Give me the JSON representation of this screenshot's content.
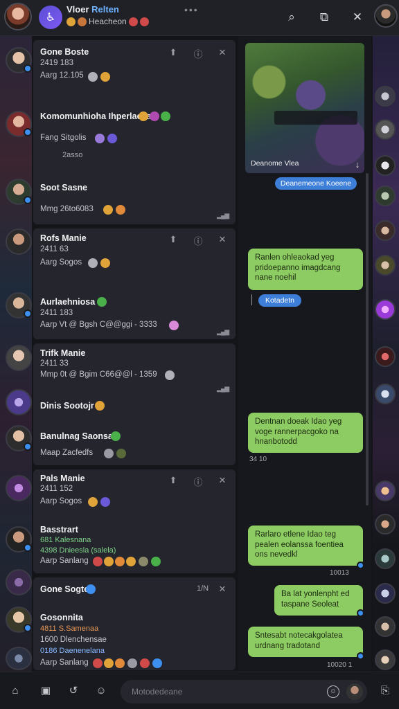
{
  "header": {
    "title_part1": "Vloer",
    "title_part2": "Relten",
    "subtitle": "Heacheon",
    "actions": [
      "search",
      "new-chat",
      "close"
    ]
  },
  "cards": [
    {
      "rows": [
        {
          "sender": "Gone Boste",
          "line1": "2419 183",
          "line2": "Aarg  12.105"
        },
        {
          "sender": "Komomunhioha Ihperlaesa",
          "line1": "Fang  Sitgolis",
          "line2": "2asso"
        },
        {
          "sender": "Soot Sasne",
          "line1": "Mmg  26to6083"
        }
      ]
    },
    {
      "rows": [
        {
          "sender": "Rofs Manie",
          "line1": "2411 63",
          "line2": "Aarg  Sogos"
        },
        {
          "sender": "Aurlaehniosa",
          "line1": "2411 183",
          "line2": "Aarp  Vt @ Bgsh  C@@ggi - 3333"
        }
      ]
    },
    {
      "rows": [
        {
          "sender": "Trifk Manie",
          "line1": "2411 33",
          "line2": "Mmp  0t @ Bgim  C66@@l - 1359"
        },
        {
          "sender": "Dinis Sootojr"
        },
        {
          "sender": "Banulnag Saonsa",
          "line1": "Maap  Zacfedfs"
        }
      ]
    },
    {
      "rows": [
        {
          "sender": "Pals Manie",
          "line1": "2411 152",
          "line2": "Aarp  Sogos"
        },
        {
          "sender": "Basstrart",
          "line1": "681  Kalesnana",
          "line2": "4398  Dnieesla (salela)",
          "line3": "Aarp  Sanlang"
        }
      ]
    },
    {
      "rows": [
        {
          "sender": "Gone Sogte",
          "count": "1/N"
        },
        {
          "sender": "Gosonnita",
          "line1": "4811 S.Samenaa",
          "line2": "1600  Dlenchensae",
          "line3": "0186  Daenenelana",
          "line4": "Aarp  Sanlang"
        }
      ]
    }
  ],
  "chat": {
    "image_caption": "Deanome Vlea",
    "pill_top": "Deanemeone Koeene",
    "bubble1": [
      "Ranlen ohleaokad yeg",
      "pridoepanno imagdcang",
      "nane noehil"
    ],
    "pill_mid": "Kotadetn",
    "bubble2": [
      "Dentnan doeak  Idao yeg",
      "voge rannerpacgoko na",
      "hnanbotodd"
    ],
    "ts2": "34 10",
    "bubble3": [
      "Rarlaro etlene  Idao teg",
      "pealen eolanssa foentiea",
      "ons nevedkl"
    ],
    "ts3": "10013",
    "bubble4": [
      "Ba lat yonlenpht ed",
      "taspane Seoleat"
    ],
    "bubble5": [
      "Sntesabt notecakgolatea",
      "urdnang tradotand"
    ],
    "ts5": "10020 1"
  },
  "composer": {
    "placeholder": "Motodedeane"
  },
  "colors": {
    "bubble_green": "#8dcc62",
    "accent_blue": "#3d8ff0",
    "card_bg": "#25262d"
  }
}
